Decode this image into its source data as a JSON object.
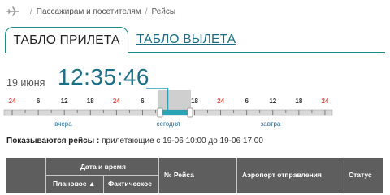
{
  "breadcrumb": {
    "items": [
      "Пассажирам и посетителям",
      "Рейсы"
    ],
    "separator": "/"
  },
  "tabs": {
    "arrivals": "ТАБЛО ПРИЛЕТА",
    "departures": "ТАБЛО ВЫЛЕТА"
  },
  "clock": {
    "date": "19 июня",
    "time": "12:35:46"
  },
  "timeline": {
    "ticks": [
      {
        "label": "24",
        "color": "#d9534f"
      },
      {
        "label": "6",
        "color": "#333333"
      },
      {
        "label": "12",
        "color": "#333333"
      },
      {
        "label": "18",
        "color": "#333333"
      },
      {
        "label": "24",
        "color": "#d9534f"
      },
      {
        "label": "6",
        "color": "#333333"
      },
      {
        "label": "12",
        "color": "#d0d0d0"
      },
      {
        "label": "18",
        "color": "#333333"
      },
      {
        "label": "24",
        "color": "#d9534f"
      },
      {
        "label": "6",
        "color": "#333333"
      },
      {
        "label": "12",
        "color": "#333333"
      },
      {
        "label": "18",
        "color": "#333333"
      },
      {
        "label": "24",
        "color": "#d9534f"
      }
    ],
    "days": [
      "вчера",
      "сегодня",
      "завтра"
    ],
    "accent": "#2aa3b5"
  },
  "showing": {
    "label": "Показываются рейсы :",
    "text": "прилетающие с 19-06 10:00 до 19-06 17:00"
  },
  "table": {
    "date_group": "Дата и время",
    "planned": "Плановое ▲",
    "actual": "Фактическое",
    "flight_no": "№ Рейса",
    "origin": "Аэропорт отправления",
    "status": "Статус"
  }
}
